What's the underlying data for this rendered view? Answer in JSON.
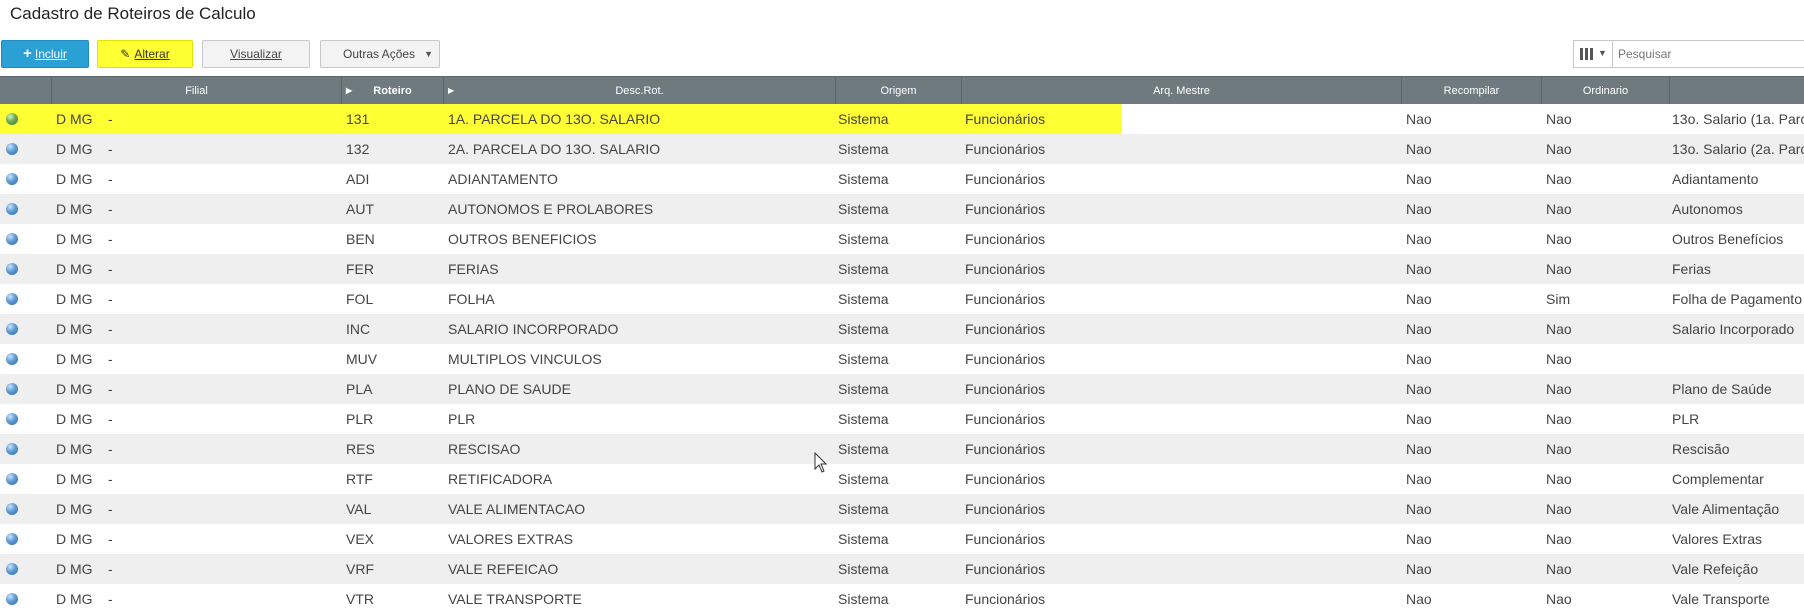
{
  "page": {
    "title": "Cadastro de Roteiros de Calculo"
  },
  "toolbar": {
    "incluir_label": "Incluir",
    "alterar_label": "Alterar",
    "visualizar_label": "Visualizar",
    "outras_label": "Outras Ações",
    "search_placeholder": "Pesquisar",
    "icons": {
      "incluir": "plus-icon",
      "alterar": "pencil-icon",
      "outras": "caret-down-icon",
      "columns": "columns-icon"
    }
  },
  "grid": {
    "columns": [
      "",
      "Filial",
      "Roteiro",
      "Desc.Rot.",
      "Origem",
      "Arq. Mestre",
      "Recompilar",
      "Ordinario",
      ""
    ],
    "sorted_column": "Roteiro",
    "rows": [
      {
        "status": "green",
        "filial": "D MG",
        "dash": "-",
        "roteiro": "131",
        "desc": "1A. PARCELA DO 13O. SALARIO",
        "origem": "Sistema",
        "arq": "Funcionários",
        "recompilar": "Nao",
        "ordinario": "Nao",
        "last": "13o. Salario (1a. Parc",
        "selected": true
      },
      {
        "status": "blue",
        "filial": "D MG",
        "dash": "-",
        "roteiro": "132",
        "desc": "2A. PARCELA DO 13O. SALARIO",
        "origem": "Sistema",
        "arq": "Funcionários",
        "recompilar": "Nao",
        "ordinario": "Nao",
        "last": "13o. Salario (2a. Parc"
      },
      {
        "status": "blue",
        "filial": "D MG",
        "dash": "-",
        "roteiro": "ADI",
        "desc": "ADIANTAMENTO",
        "origem": "Sistema",
        "arq": "Funcionários",
        "recompilar": "Nao",
        "ordinario": "Nao",
        "last": "Adiantamento"
      },
      {
        "status": "blue",
        "filial": "D MG",
        "dash": "-",
        "roteiro": "AUT",
        "desc": "AUTONOMOS E PROLABORES",
        "origem": "Sistema",
        "arq": "Funcionários",
        "recompilar": "Nao",
        "ordinario": "Nao",
        "last": "Autonomos"
      },
      {
        "status": "blue",
        "filial": "D MG",
        "dash": "-",
        "roteiro": "BEN",
        "desc": "OUTROS BENEFICIOS",
        "origem": "Sistema",
        "arq": "Funcionários",
        "recompilar": "Nao",
        "ordinario": "Nao",
        "last": "Outros Benefícios"
      },
      {
        "status": "blue",
        "filial": "D MG",
        "dash": "-",
        "roteiro": "FER",
        "desc": "FERIAS",
        "origem": "Sistema",
        "arq": "Funcionários",
        "recompilar": "Nao",
        "ordinario": "Nao",
        "last": "Ferias"
      },
      {
        "status": "blue",
        "filial": "D MG",
        "dash": "-",
        "roteiro": "FOL",
        "desc": "FOLHA",
        "origem": "Sistema",
        "arq": "Funcionários",
        "recompilar": "Nao",
        "ordinario": "Sim",
        "last": "Folha de Pagamento"
      },
      {
        "status": "blue",
        "filial": "D MG",
        "dash": "-",
        "roteiro": "INC",
        "desc": "SALARIO INCORPORADO",
        "origem": "Sistema",
        "arq": "Funcionários",
        "recompilar": "Nao",
        "ordinario": "Nao",
        "last": "Salario Incorporado"
      },
      {
        "status": "blue",
        "filial": "D MG",
        "dash": "-",
        "roteiro": "MUV",
        "desc": "MULTIPLOS VINCULOS",
        "origem": "Sistema",
        "arq": "Funcionários",
        "recompilar": "Nao",
        "ordinario": "Nao",
        "last": ""
      },
      {
        "status": "blue",
        "filial": "D MG",
        "dash": "-",
        "roteiro": "PLA",
        "desc": "PLANO DE SAUDE",
        "origem": "Sistema",
        "arq": "Funcionários",
        "recompilar": "Nao",
        "ordinario": "Nao",
        "last": "Plano de Saúde"
      },
      {
        "status": "blue",
        "filial": "D MG",
        "dash": "-",
        "roteiro": "PLR",
        "desc": "PLR",
        "origem": "Sistema",
        "arq": "Funcionários",
        "recompilar": "Nao",
        "ordinario": "Nao",
        "last": "PLR"
      },
      {
        "status": "blue",
        "filial": "D MG",
        "dash": "-",
        "roteiro": "RES",
        "desc": "RESCISAO",
        "origem": "Sistema",
        "arq": "Funcionários",
        "recompilar": "Nao",
        "ordinario": "Nao",
        "last": "Rescisão"
      },
      {
        "status": "blue",
        "filial": "D MG",
        "dash": "-",
        "roteiro": "RTF",
        "desc": "RETIFICADORA",
        "origem": "Sistema",
        "arq": "Funcionários",
        "recompilar": "Nao",
        "ordinario": "Nao",
        "last": "Complementar"
      },
      {
        "status": "blue",
        "filial": "D MG",
        "dash": "-",
        "roteiro": "VAL",
        "desc": "VALE ALIMENTACAO",
        "origem": "Sistema",
        "arq": "Funcionários",
        "recompilar": "Nao",
        "ordinario": "Nao",
        "last": "Vale Alimentação"
      },
      {
        "status": "blue",
        "filial": "D MG",
        "dash": "-",
        "roteiro": "VEX",
        "desc": "VALORES EXTRAS",
        "origem": "Sistema",
        "arq": "Funcionários",
        "recompilar": "Nao",
        "ordinario": "Nao",
        "last": "Valores Extras"
      },
      {
        "status": "blue",
        "filial": "D MG",
        "dash": "-",
        "roteiro": "VRF",
        "desc": "VALE REFEICAO",
        "origem": "Sistema",
        "arq": "Funcionários",
        "recompilar": "Nao",
        "ordinario": "Nao",
        "last": "Vale Refeição"
      },
      {
        "status": "blue",
        "filial": "D MG",
        "dash": "-",
        "roteiro": "VTR",
        "desc": "VALE TRANSPORTE",
        "origem": "Sistema",
        "arq": "Funcionários",
        "recompilar": "Nao",
        "ordinario": "Nao",
        "last": "Vale Transporte"
      }
    ]
  },
  "colors": {
    "primary": "#2aa0d4",
    "highlight": "#ffff33",
    "header_bg": "#6f7a80",
    "row_alt": "#efefef"
  }
}
